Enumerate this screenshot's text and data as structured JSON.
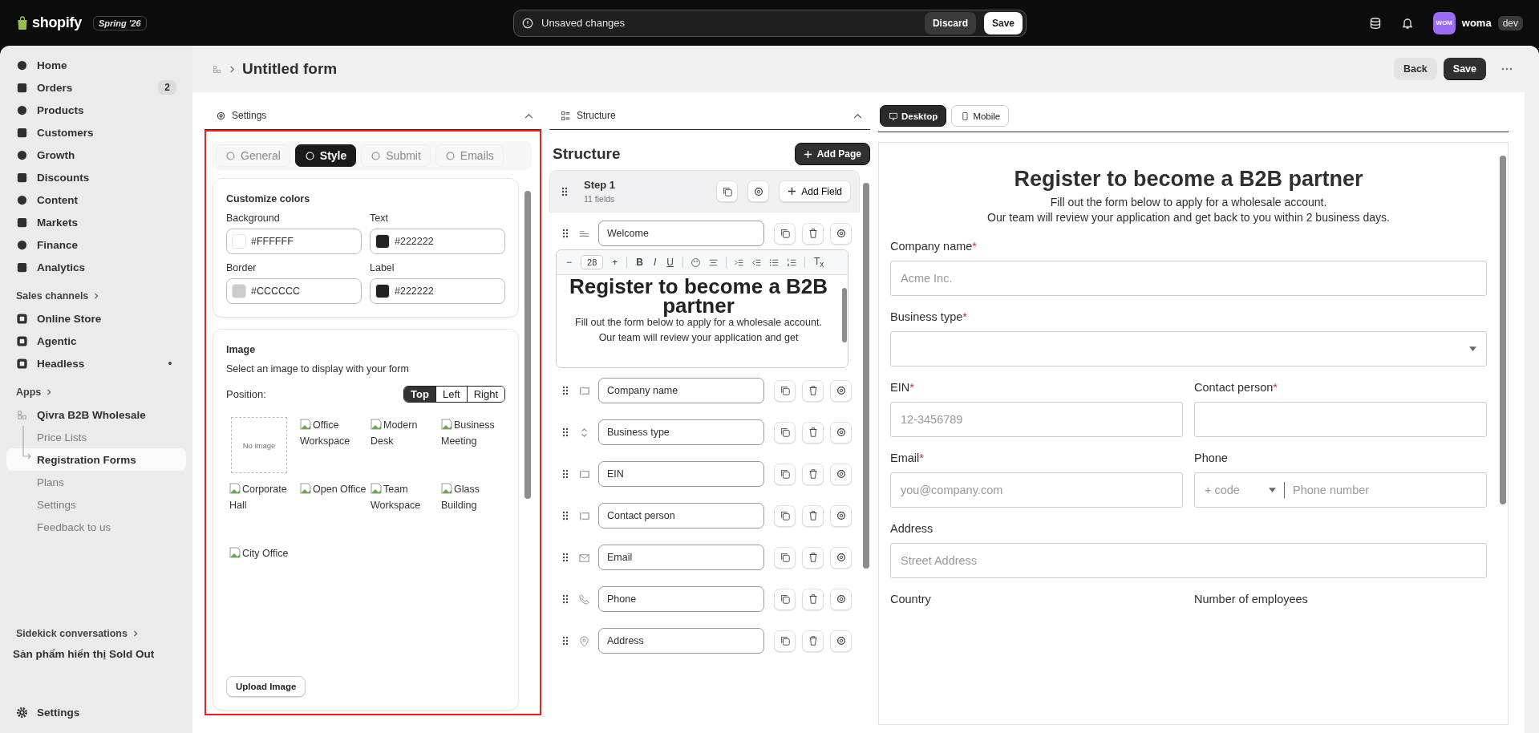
{
  "topbar": {
    "logo": "shopify",
    "edition": "Spring '26",
    "unsaved": "Unsaved changes",
    "discard": "Discard",
    "save": "Save",
    "avatar": "WOM",
    "user": "woma",
    "store_tag": "dev"
  },
  "sidebar": {
    "items": [
      {
        "label": "Home",
        "dot": false
      },
      {
        "label": "Orders",
        "badge": "2",
        "dot": false
      },
      {
        "label": "Products",
        "dot": false
      },
      {
        "label": "Customers",
        "dot": false
      },
      {
        "label": "Growth",
        "dot": false
      },
      {
        "label": "Discounts",
        "dot": false
      },
      {
        "label": "Content",
        "dot": false
      },
      {
        "label": "Markets",
        "dot": false
      },
      {
        "label": "Finance",
        "dot": false
      },
      {
        "label": "Analytics",
        "dot": false
      }
    ],
    "sales_channels": {
      "title": "Sales channels",
      "items": [
        {
          "label": "Online Store",
          "dot": false
        },
        {
          "label": "Agentic",
          "dot": false
        },
        {
          "label": "Headless",
          "dot": true
        }
      ]
    },
    "apps": {
      "title": "Apps",
      "app": "Qivra B2B Wholesale",
      "children": [
        {
          "label": "Price Lists",
          "selected": false
        },
        {
          "label": "Registration Forms",
          "selected": true
        },
        {
          "label": "Plans",
          "selected": false
        },
        {
          "label": "Settings",
          "selected": false
        },
        {
          "label": "Feedback to us",
          "selected": false
        }
      ]
    },
    "sidekick": {
      "title": "Sidekick conversations",
      "items": [
        "Sản phẩm hiển thị Sold Out"
      ]
    },
    "settings": "Settings"
  },
  "page_header": {
    "title": "Untitled form",
    "back": "Back",
    "save": "Save"
  },
  "settings_panel": {
    "title": "Settings",
    "tabs": [
      {
        "label": "General",
        "selected": false
      },
      {
        "label": "Style",
        "selected": true
      },
      {
        "label": "Submit",
        "selected": false
      },
      {
        "label": "Emails",
        "selected": false
      }
    ],
    "colors": {
      "title": "Customize colors",
      "fields": [
        {
          "label": "Background",
          "value": "#FFFFFF",
          "color": "#ffffff"
        },
        {
          "label": "Text",
          "value": "#222222",
          "color": "#222222"
        },
        {
          "label": "Border",
          "value": "#CCCCCC",
          "color": "#cccccc"
        },
        {
          "label": "Label",
          "value": "#222222",
          "color": "#222222"
        }
      ]
    },
    "image": {
      "title": "Image",
      "description": "Select an image to display with your form",
      "position_label": "Position:",
      "positions": [
        {
          "label": "Top",
          "selected": true
        },
        {
          "label": "Left",
          "selected": false
        },
        {
          "label": "Right",
          "selected": false
        }
      ],
      "options": [
        {
          "kind": "empty",
          "label": "No image"
        },
        {
          "kind": "broken",
          "label": "Office Workspace"
        },
        {
          "kind": "broken",
          "label": "Modern Desk"
        },
        {
          "kind": "broken",
          "label": "Business Meeting"
        },
        {
          "kind": "broken",
          "label": "Corporate Hall"
        },
        {
          "kind": "broken",
          "label": "Open Office"
        },
        {
          "kind": "broken",
          "label": "Team Workspace"
        },
        {
          "kind": "broken",
          "label": "Glass Building"
        },
        {
          "kind": "broken",
          "label": "City Office"
        }
      ],
      "upload": "Upload Image"
    }
  },
  "structure_panel": {
    "title": "Structure",
    "heading": "Structure",
    "add_page": "Add Page",
    "step": {
      "title": "Step 1",
      "subtitle": "11 fields",
      "add_field": "Add Field"
    },
    "fields": [
      {
        "kind": "text",
        "label": "Welcome"
      },
      {
        "kind": "input",
        "label": "Company name"
      },
      {
        "kind": "select",
        "label": "Business type"
      },
      {
        "kind": "input",
        "label": "EIN"
      },
      {
        "kind": "input",
        "label": "Contact person"
      },
      {
        "kind": "email",
        "label": "Email"
      },
      {
        "kind": "phone",
        "label": "Phone"
      },
      {
        "kind": "address",
        "label": "Address"
      }
    ],
    "editor": {
      "decrease": "−",
      "size": "28",
      "increase": "+",
      "bold": "B",
      "italic": "I",
      "underline": "U",
      "clear": "T$_{x}$",
      "heading": "Register to become a B2B partner",
      "body": [
        "Fill out the form below to apply for a wholesale account.",
        "Our team will review your application and get"
      ]
    }
  },
  "preview": {
    "required_mark": "*",
    "tabs": [
      {
        "label": "Desktop",
        "selected": true
      },
      {
        "label": "Mobile",
        "selected": false
      }
    ],
    "title": "Register to become a B2B partner",
    "subtitle": [
      "Fill out the form below to apply for a wholesale account.",
      "Our team will review your application and get back to you within 2 business days."
    ],
    "rows": [
      [
        {
          "kind": "text",
          "label": "Company name",
          "required": true,
          "placeholder": "Acme Inc."
        }
      ],
      [
        {
          "kind": "select",
          "label": "Business type",
          "required": true
        }
      ],
      [
        {
          "kind": "text",
          "label": "EIN",
          "required": true,
          "placeholder": "12-3456789"
        },
        {
          "kind": "text",
          "label": "Contact person",
          "required": true
        }
      ],
      [
        {
          "kind": "text",
          "label": "Email",
          "required": true,
          "placeholder": "you@company.com"
        },
        {
          "kind": "phone",
          "label": "Phone",
          "required": false,
          "code": "+ code",
          "placeholder": "Phone number"
        }
      ],
      [
        {
          "kind": "text",
          "label": "Address",
          "required": false,
          "placeholder": "Street Address"
        }
      ],
      [
        {
          "kind": "label",
          "label": "Country",
          "required": false
        },
        {
          "kind": "label",
          "label": "Number of employees",
          "required": false
        }
      ]
    ]
  }
}
